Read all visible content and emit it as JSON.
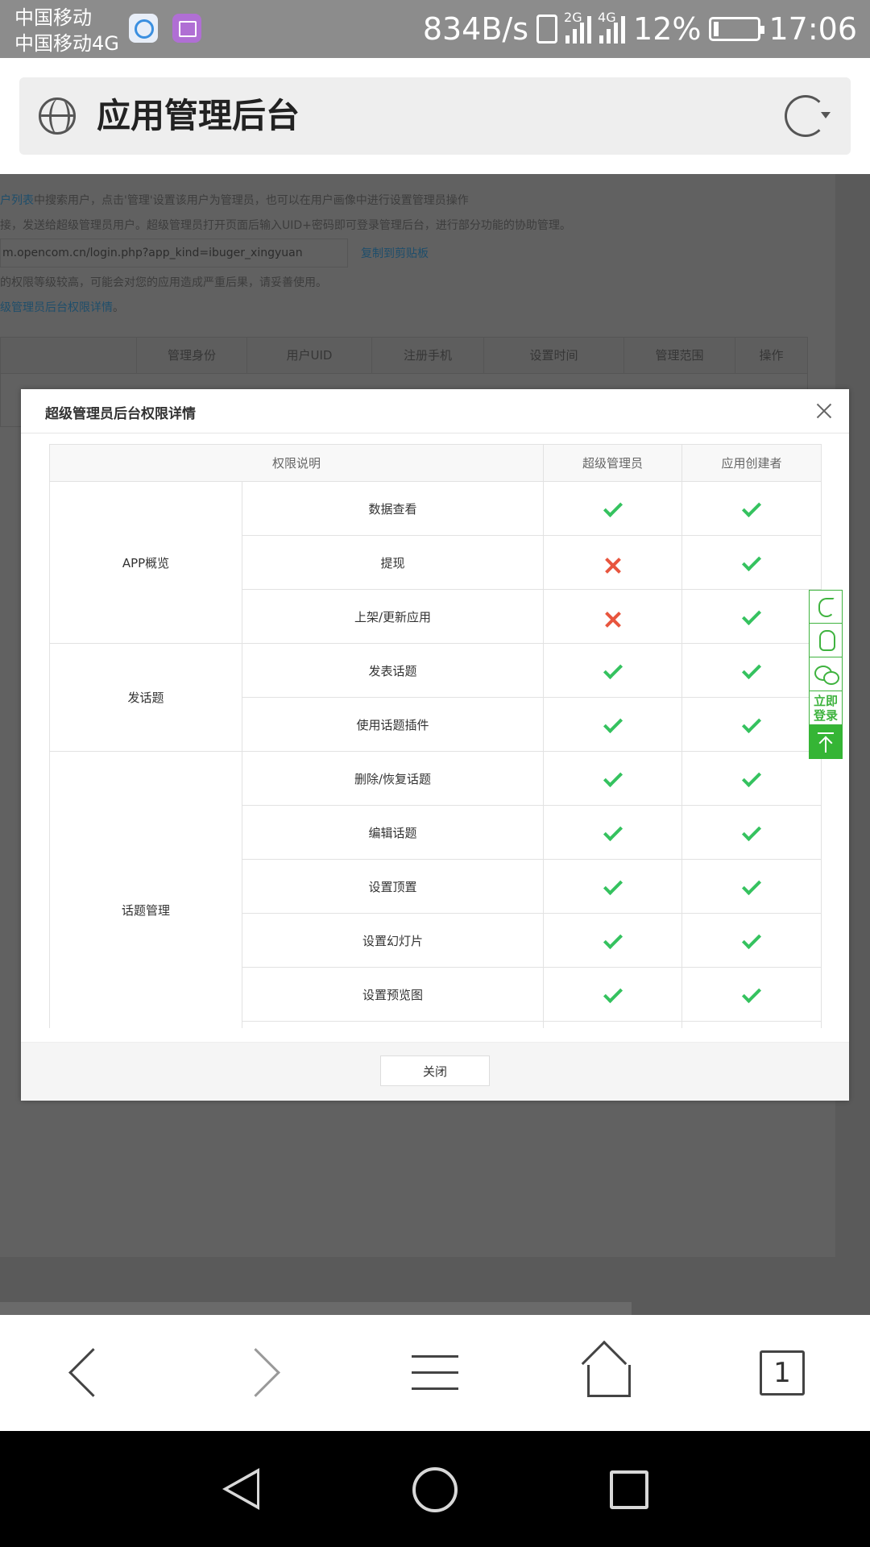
{
  "status_bar": {
    "carrier1": "中国移动",
    "carrier2": "中国移动4G",
    "net_speed": "834B/s",
    "signal1_tag": "2G",
    "signal2_tag": "4G",
    "battery": "12%",
    "time": "17:06"
  },
  "browser": {
    "title": "应用管理后台"
  },
  "background_page": {
    "line1_link": "户列表",
    "line1_text": "中搜索用户，点击'管理'设置该用户为管理员，也可以在用户画像中进行设置管理员操作",
    "line2_text": "接，发送给超级管理员用户。超级管理员打开页面后输入UID+密码即可登录管理后台，进行部分功能的协助管理。",
    "url_value": "m.opencom.cn/login.php?app_kind=ibuger_xingyuan",
    "copy_label": "复制到剪贴板",
    "line4_text": "的权限等级较高，可能会对您的应用造成严重后果，请妥善使用。",
    "line5_link": "级管理员后台权限详情",
    "line5_suffix": "。",
    "table_headers": [
      "管理身份",
      "用户UID",
      "注册手机",
      "设置时间",
      "管理范围",
      "操作"
    ]
  },
  "modal": {
    "title": "超级管理员后台权限详情",
    "close_button": "关闭",
    "table": {
      "headers": [
        "权限说明",
        "超级管理员",
        "应用创建者"
      ],
      "groups": [
        "APP概览",
        "发话题",
        "话题管理"
      ],
      "rows": [
        {
          "permission": "数据查看",
          "super_admin": true,
          "creator": true
        },
        {
          "permission": "提现",
          "super_admin": false,
          "creator": true
        },
        {
          "permission": "上架/更新应用",
          "super_admin": false,
          "creator": true
        },
        {
          "permission": "发表话题",
          "super_admin": true,
          "creator": true
        },
        {
          "permission": "使用话题插件",
          "super_admin": true,
          "creator": true
        },
        {
          "permission": "删除/恢复话题",
          "super_admin": true,
          "creator": true
        },
        {
          "permission": "编辑话题",
          "super_admin": true,
          "creator": true
        },
        {
          "permission": "设置顶置",
          "super_admin": true,
          "creator": true
        },
        {
          "permission": "设置幻灯片",
          "super_admin": true,
          "creator": true
        },
        {
          "permission": "设置预览图",
          "super_admin": true,
          "creator": true
        }
      ]
    }
  },
  "side_tools": {
    "login_label": "立即登录"
  },
  "tab_count": "1",
  "colors": {
    "check": "#35c25f",
    "cross": "#e8553e",
    "side_accent": "#3fb33f"
  },
  "icons": {
    "check": "check-icon",
    "cross": "cross-icon"
  }
}
